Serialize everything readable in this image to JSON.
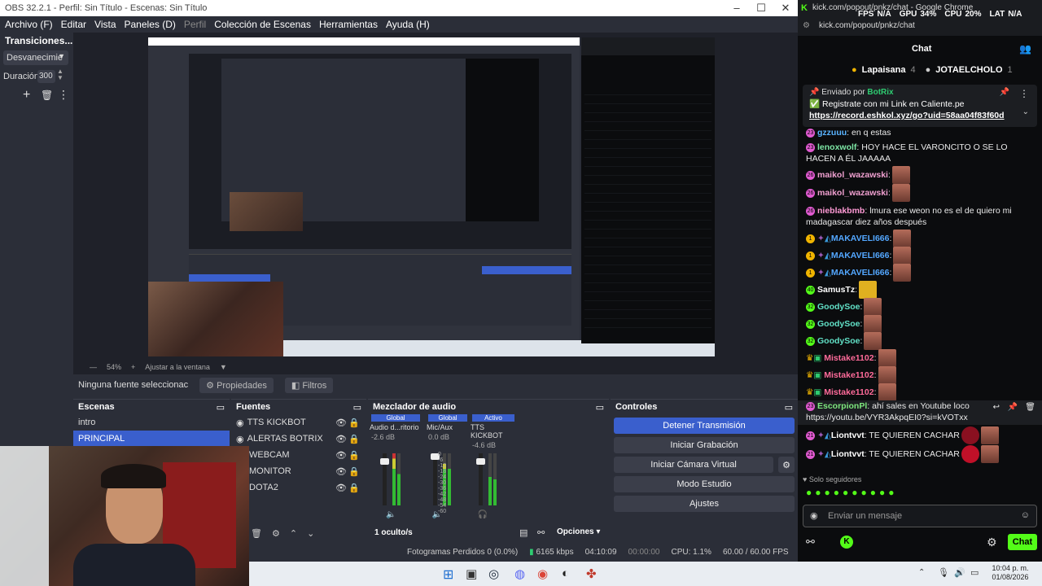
{
  "obs": {
    "title": "OBS 32.2.1 - Perfil: Sin Título - Escenas: Sin Título",
    "menu": [
      "Archivo (F)",
      "Editar",
      "Vista",
      "Paneles (D)",
      "Perfil",
      "Colección de Escenas",
      "Herramientas",
      "Ayuda (H)"
    ],
    "transitions": {
      "title": "Transiciones...",
      "type": "Desvanecimie",
      "duration_label": "Duración",
      "duration_value": "300"
    },
    "zoom": {
      "level": "54%",
      "fit": "Ajustar a la ventana"
    },
    "source_toolbar": {
      "no_source": "Ninguna fuente seleccionac",
      "properties": "Propiedades",
      "filters": "Filtros"
    },
    "scenes": {
      "title": "Escenas",
      "items": [
        "intro",
        "PRINCIPAL"
      ],
      "selected": "PRINCIPAL"
    },
    "sources": {
      "title": "Fuentes",
      "items": [
        "TTS KICKBOT",
        "ALERTAS BOTRIX",
        "WEBCAM",
        "MONITOR",
        "DOTA2"
      ]
    },
    "mixer": {
      "title": "Mezclador de audio",
      "channels": [
        {
          "tag": "Global",
          "name": "Audio d...ritorio",
          "db": "-2.6 dB"
        },
        {
          "tag": "Global",
          "name": "Mic/Aux",
          "db": "0.0 dB"
        },
        {
          "tag": "Activo",
          "name": "TTS KICKBOT",
          "db": "-4.6 dB"
        }
      ],
      "scale": [
        "0",
        "-6",
        "-12",
        "-18",
        "-24",
        "-30",
        "-36",
        "-42",
        "-48",
        "-54",
        "-60"
      ],
      "hidden": "1 oculto/s",
      "options": "Opciones"
    },
    "controls": {
      "title": "Controles",
      "stop_stream": "Detener Transmisión",
      "start_record": "Iniciar Grabación",
      "virtual_cam": "Iniciar Cámara Virtual",
      "studio": "Modo Estudio",
      "settings": "Ajustes"
    },
    "status": {
      "dropped": "Fotogramas Perdidos 0 (0.0%)",
      "bitrate": "6165 kbps",
      "stream_time": "04:10:09",
      "rec_time": "00:00:00",
      "cpu": "CPU: 1.1%",
      "fps": "60.00 / 60.00 FPS"
    }
  },
  "chrome": {
    "title": "kick.com/popout/pnkz/chat - Google Chrome",
    "url": "kick.com/popout/pnkz/chat",
    "overlay": {
      "fps_label": "FPS",
      "fps": "N/A",
      "gpu_label": "GPU",
      "gpu": "34%",
      "cpu_label": "CPU",
      "cpu": "20%",
      "lat_label": "LAT",
      "lat": "N/A"
    }
  },
  "chat": {
    "header": "Chat",
    "leaders": [
      {
        "name": "Lapaisana",
        "count": "4"
      },
      {
        "name": "JOTAELCHOLO",
        "count": "1"
      }
    ],
    "pinned": {
      "by_label": "Enviado por",
      "by": "BotRix",
      "text": "Registrate con mi Link en Caliente.pe",
      "link": "https://record.eshkol.xyz/go?uid=58aa04f83f60d"
    },
    "messages": [
      {
        "badge": "23",
        "user": "gzzuuu",
        "text": ": en q estas",
        "color": "#5ab4ff",
        "emotes": 0
      },
      {
        "badge": "23",
        "user": "lenoxwolf",
        "text": ": HOY HACE EL VARONCITO O SE LO HACEN A ÉL JAAAAA",
        "color": "#7ee8a6",
        "emotes": 0
      },
      {
        "badge": "26",
        "user": "maikol_wazawski",
        "text": ":",
        "color": "#f0a0d0",
        "emotes": 1
      },
      {
        "badge": "26",
        "user": "maikol_wazawski",
        "text": ":",
        "color": "#f0a0d0",
        "emotes": 1
      },
      {
        "badge": "26",
        "user": "nieblakbmb",
        "text": ": lmura ese weon no es el de quiero mi madagascar diez años después",
        "color": "#ff9ad5",
        "emotes": 0
      },
      {
        "badge": "1",
        "user": "MAKAVELI666",
        "text": ":",
        "color": "#53a7ff",
        "emotes": 1
      },
      {
        "badge": "1",
        "user": "MAKAVELI666",
        "text": ":",
        "color": "#53a7ff",
        "emotes": 1
      },
      {
        "badge": "1",
        "user": "MAKAVELI666",
        "text": ":",
        "color": "#53a7ff",
        "emotes": 1
      },
      {
        "badge": "40",
        "user": "SamusTz",
        "text": ":",
        "color": "#ffffff",
        "emotes": 1
      },
      {
        "badge": "32",
        "user": "GoodySoe",
        "text": ":",
        "color": "#61e0c6",
        "emotes": 1
      },
      {
        "badge": "32",
        "user": "GoodySoe",
        "text": ":",
        "color": "#61e0c6",
        "emotes": 1
      },
      {
        "badge": "32",
        "user": "GoodySoe",
        "text": ":",
        "color": "#61e0c6",
        "emotes": 1
      },
      {
        "badge": "",
        "user": "Mistake1102",
        "text": ":",
        "color": "#ff6b9a",
        "emotes": 1
      },
      {
        "badge": "",
        "user": "Mistake1102",
        "text": ":",
        "color": "#ff6b9a",
        "emotes": 1
      },
      {
        "badge": "",
        "user": "Mistake1102",
        "text": ":",
        "color": "#ff6b9a",
        "emotes": 1
      },
      {
        "badge": "23",
        "user": "EscorpionPl",
        "text": ": ahí sales en Youtube loco https://youtu.be/VYR3AkpqEI0?si=kVOTxx",
        "color": "#7ee87e",
        "emotes": 0
      },
      {
        "badge": "21",
        "user": "Liontvvt",
        "text": ": TE QUIEREN CACHAR",
        "color": "#ffffff",
        "emotes": 2
      },
      {
        "badge": "21",
        "user": "Liontvvt",
        "text": ": TE QUIEREN CACHAR",
        "color": "#ffffff",
        "emotes": 2
      }
    ],
    "followers_only": "Solo seguidores",
    "input_placeholder": "Enviar un mensaje",
    "send": "Chat"
  },
  "taskbar": {
    "time": "10:04 p. m.",
    "date": "01/08/2026"
  }
}
